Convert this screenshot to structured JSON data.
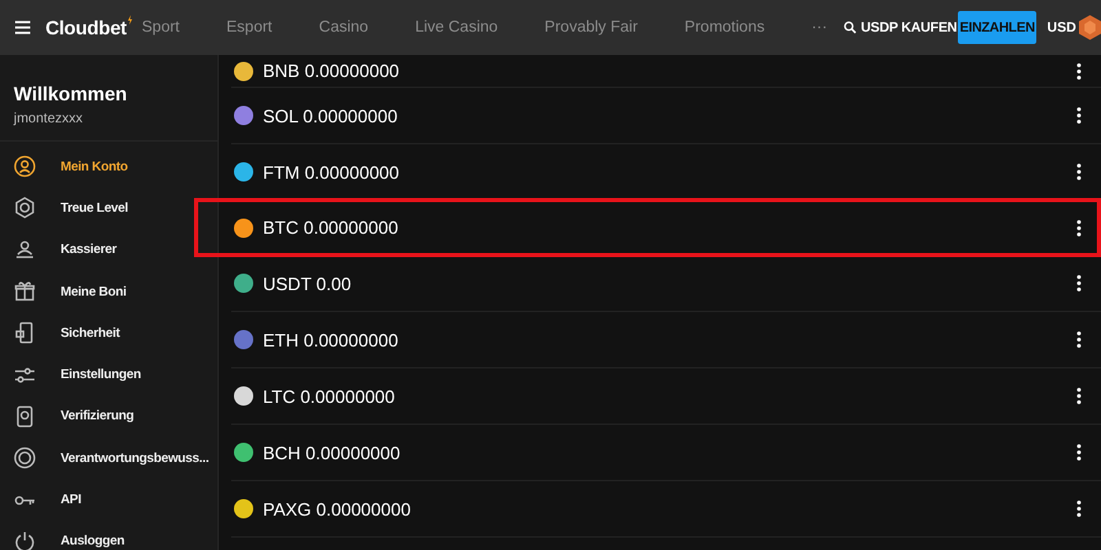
{
  "topbar": {
    "logo": "Cloudbet",
    "nav": [
      {
        "label": "Sport"
      },
      {
        "label": "Esport"
      },
      {
        "label": "Casino"
      },
      {
        "label": "Live Casino"
      },
      {
        "label": "Provably Fair"
      },
      {
        "label": "Promotions"
      },
      {
        "label": "···"
      }
    ],
    "buy_link": "USDP KAUFEN",
    "deposit_button": "EINZAHLEN",
    "currency": "USD"
  },
  "sidebar": {
    "greeting": "Willkommen",
    "username": "jmontezxxx",
    "items": [
      {
        "label": "Mein Konto",
        "selected": true
      },
      {
        "label": "Treue Level",
        "selected": false
      },
      {
        "label": "Kassierer",
        "selected": false
      },
      {
        "label": "Meine Boni",
        "selected": false
      },
      {
        "label": "Sicherheit",
        "selected": false
      },
      {
        "label": "Einstellungen",
        "selected": false
      },
      {
        "label": "Verifizierung",
        "selected": false
      },
      {
        "label": "Verantwortungsbewuss...",
        "selected": false
      },
      {
        "label": "API",
        "selected": false
      },
      {
        "label": "Ausloggen",
        "selected": false
      }
    ]
  },
  "wallets": [
    {
      "balance": "BNB 0.00000000",
      "color": "#e8b83a",
      "highlighted": false
    },
    {
      "balance": "SOL 0.00000000",
      "color": "#8f7fe0",
      "highlighted": false
    },
    {
      "balance": "FTM 0.00000000",
      "color": "#2bb5e8",
      "highlighted": false
    },
    {
      "balance": "BTC 0.00000000",
      "color": "#f7931a",
      "highlighted": true
    },
    {
      "balance": "USDT 0.00",
      "color": "#3fae8a",
      "highlighted": false
    },
    {
      "balance": "ETH 0.00000000",
      "color": "#6672c8",
      "highlighted": false
    },
    {
      "balance": "LTC 0.00000000",
      "color": "#d8d8d8",
      "highlighted": false
    },
    {
      "balance": "BCH 0.00000000",
      "color": "#3fc070",
      "highlighted": false
    },
    {
      "balance": "PAXG 0.00000000",
      "color": "#e3c319",
      "highlighted": false
    }
  ]
}
